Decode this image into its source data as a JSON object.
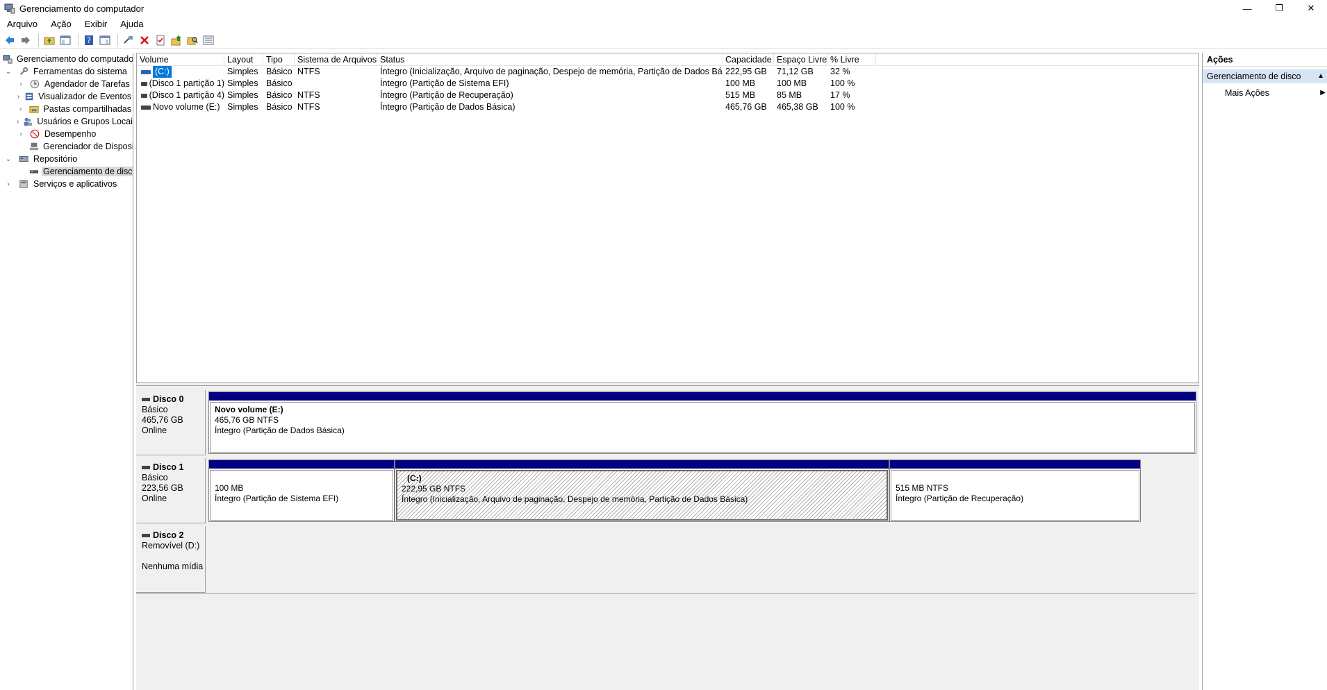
{
  "window": {
    "title": "Gerenciamento do computador",
    "minimize": "—",
    "restore": "❐",
    "close": "✕"
  },
  "menu": [
    "Arquivo",
    "Ação",
    "Exibir",
    "Ajuda"
  ],
  "tree": {
    "root": "Gerenciamento do computador (Local)",
    "system_tools": "Ferramentas do sistema",
    "task_scheduler": "Agendador de Tarefas",
    "event_viewer": "Visualizador de Eventos",
    "shared_folders": "Pastas compartilhadas",
    "local_users": "Usuários e Grupos Locais",
    "performance": "Desempenho",
    "device_manager": "Gerenciador de Dispositivos",
    "storage": "Repositório",
    "disk_management": "Gerenciamento de disco",
    "services": "Serviços e aplicativos"
  },
  "volumes": {
    "headers": [
      "Volume",
      "Layout",
      "Tipo",
      "Sistema de Arquivos",
      "Status",
      "Capacidade",
      "Espaço Livre",
      "% Livre"
    ],
    "rows": [
      [
        "(C:)",
        "Simples",
        "Básico",
        "NTFS",
        "Íntegro (Inicialização, Arquivo de paginação, Despejo de memória, Partição de Dados Básica)",
        "222,95 GB",
        "71,12 GB",
        "32 %"
      ],
      [
        "(Disco 1 partição 1)",
        "Simples",
        "Básico",
        "",
        "Íntegro (Partição de Sistema EFI)",
        "100 MB",
        "100 MB",
        "100 %"
      ],
      [
        "(Disco 1 partição 4)",
        "Simples",
        "Básico",
        "NTFS",
        "Íntegro (Partição de Recuperação)",
        "515 MB",
        "85 MB",
        "17 %"
      ],
      [
        "Novo volume (E:)",
        "Simples",
        "Básico",
        "NTFS",
        "Íntegro (Partição de Dados Básica)",
        "465,76 GB",
        "465,38 GB",
        "100 %"
      ]
    ]
  },
  "disks": {
    "disk0": {
      "name": "Disco 0",
      "type": "Básico",
      "size": "465,76 GB",
      "state": "Online",
      "p1": {
        "name": "Novo volume  (E:)",
        "size": "465,76 GB NTFS",
        "status": "Íntegro (Partição de Dados Básica)"
      }
    },
    "disk1": {
      "name": "Disco 1",
      "type": "Básico",
      "size": "223,56 GB",
      "state": "Online",
      "p1": {
        "size": "100 MB",
        "status": "Íntegro (Partição de Sistema EFI)"
      },
      "p2": {
        "name": "(C:)",
        "size": "222,95 GB NTFS",
        "status": "Íntegro (Inicialização, Arquivo de paginação, Despejo de memória, Partição de Dados Básica)"
      },
      "p3": {
        "size": "515 MB NTFS",
        "status": "Íntegro (Partição de Recuperação)"
      }
    },
    "disk2": {
      "name": "Disco 2",
      "type": "Removível (D:)",
      "state": "Nenhuma mídia"
    }
  },
  "actions": {
    "header": "Ações",
    "section": "Gerenciamento de disco",
    "more": "Mais Ações"
  },
  "colors": {
    "partition_bar": "#000080",
    "selection": "#0078d7",
    "actions_section": "#d6e4f5"
  }
}
